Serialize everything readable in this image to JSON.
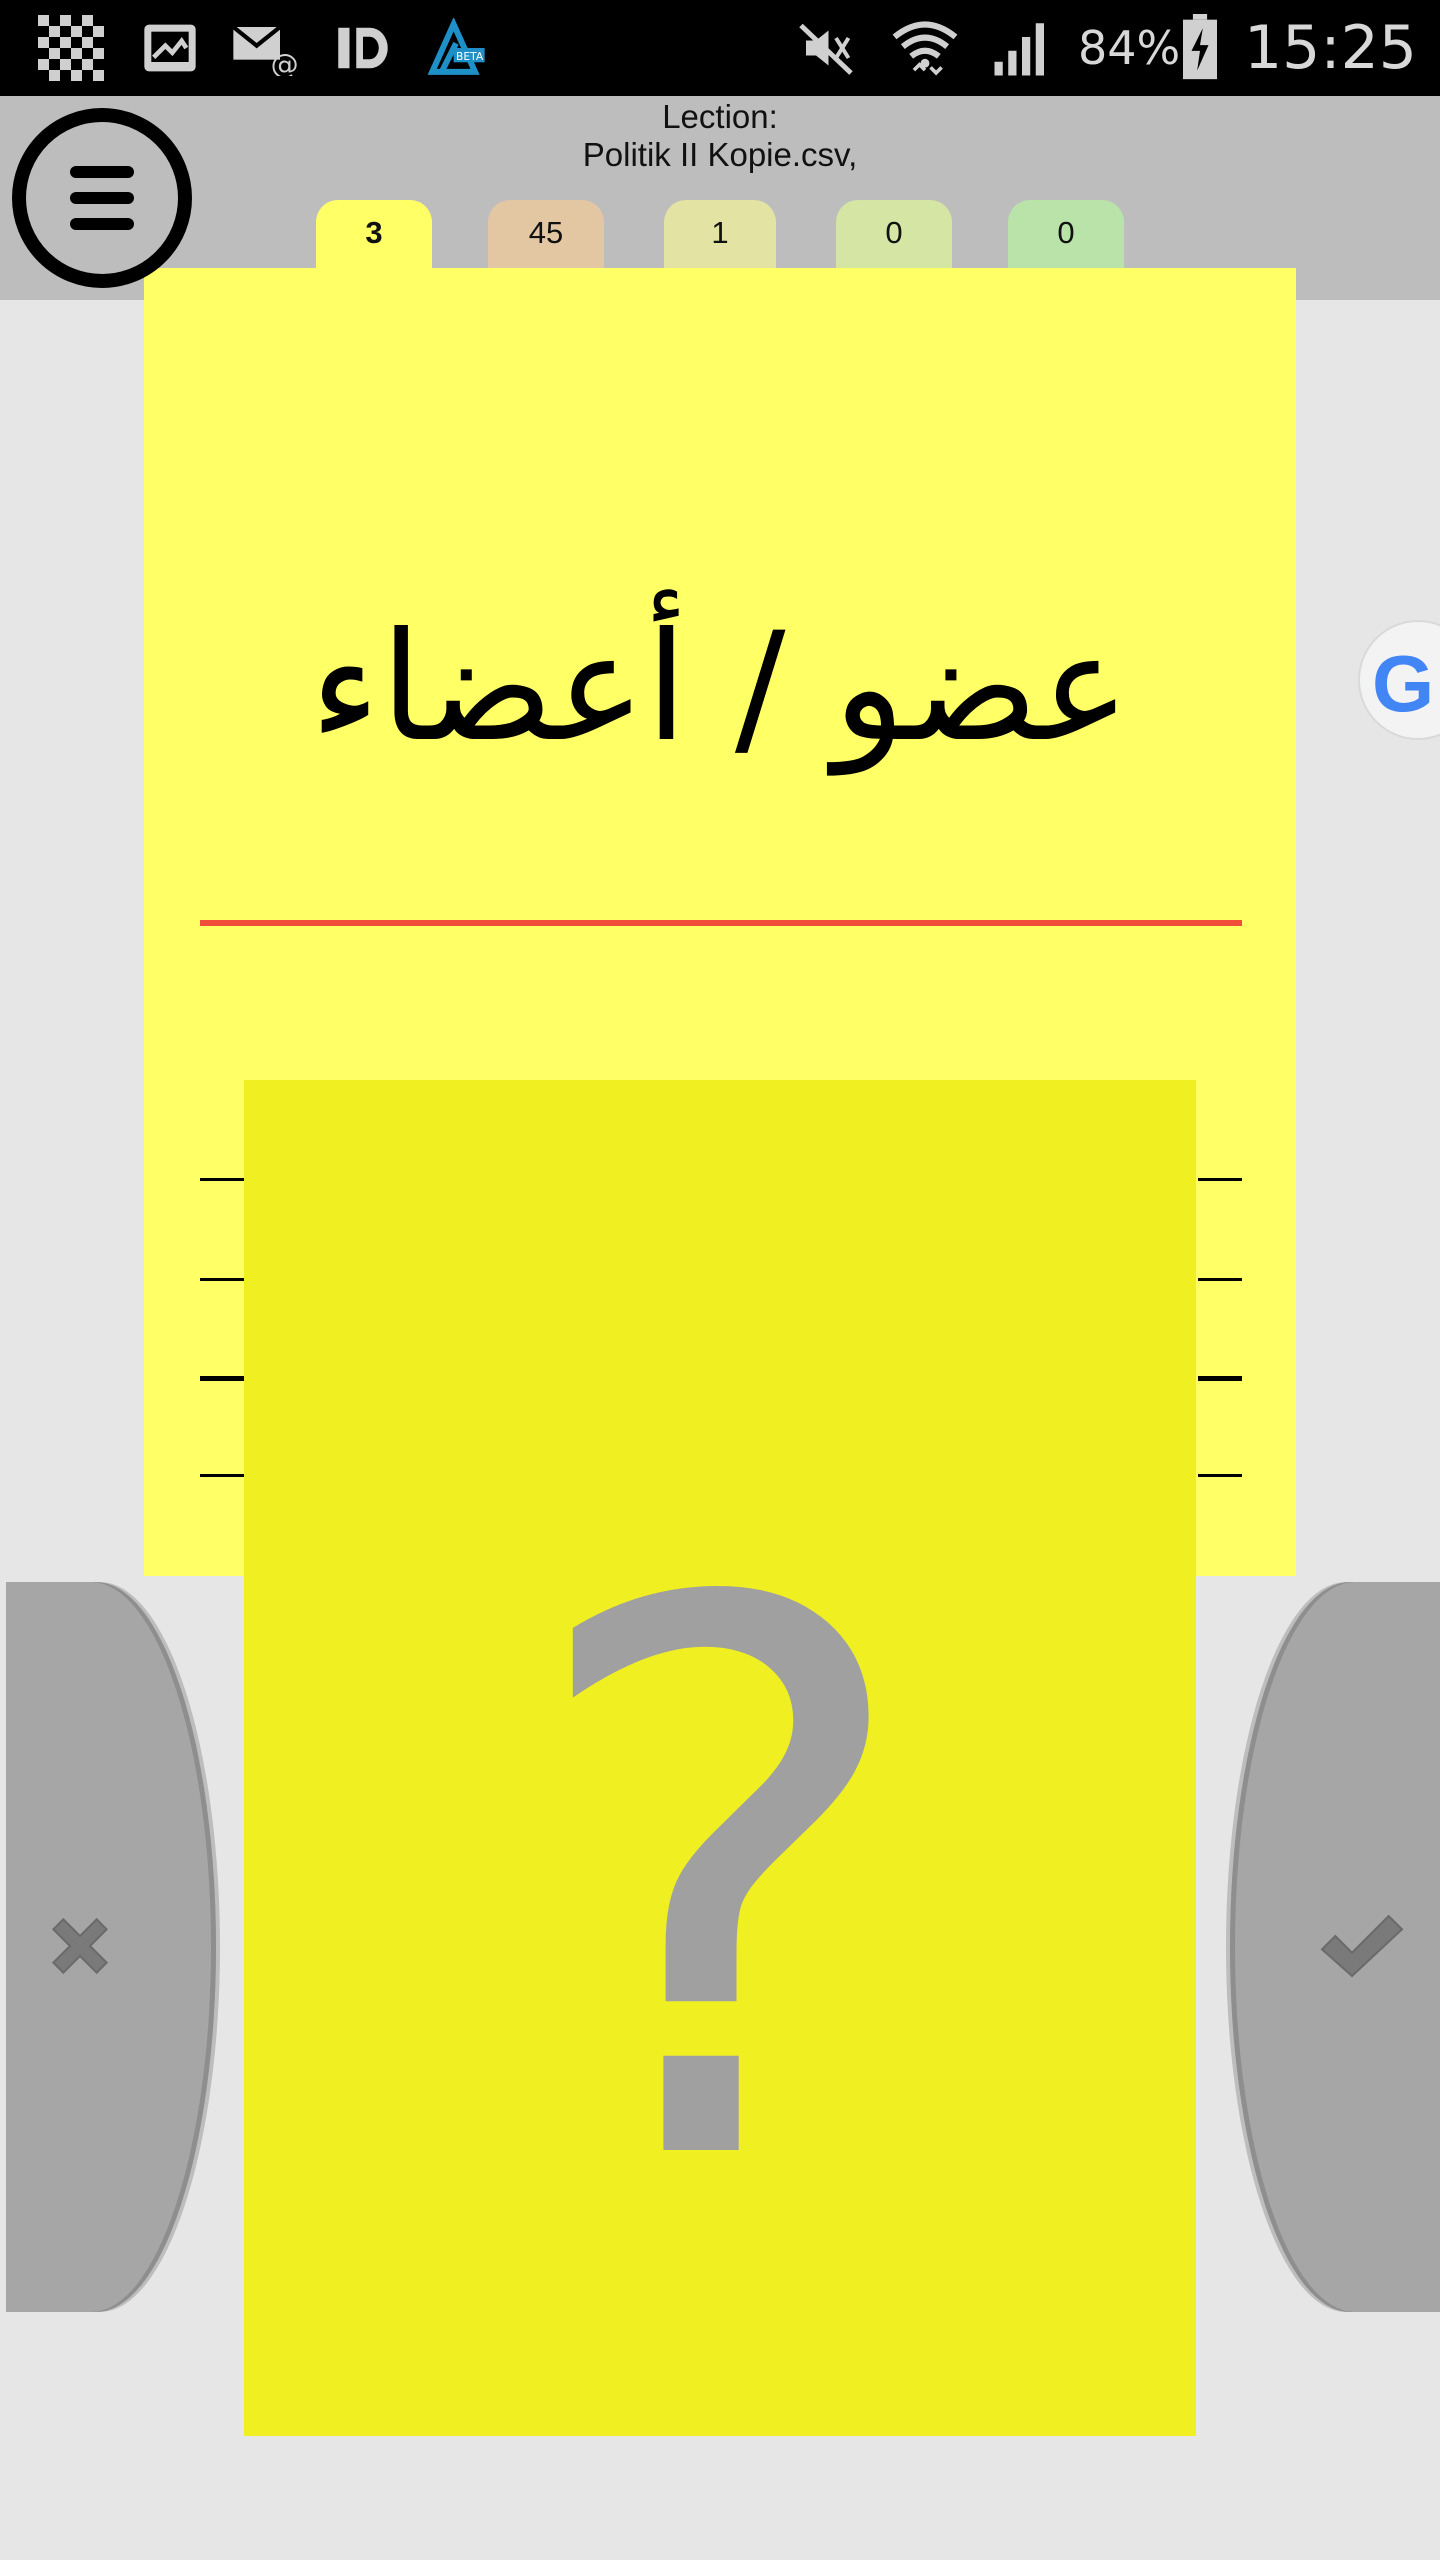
{
  "status_bar": {
    "icons_left": [
      "checker-icon",
      "image-icon",
      "mail-at-icon",
      "id-icon",
      "beta-app-icon"
    ],
    "icons_right": [
      "mute-icon",
      "wifi-icon",
      "signal-icon"
    ],
    "battery": "84%",
    "time": "15:25",
    "beta_badge": "BETA"
  },
  "header": {
    "lection_label": "Lection:",
    "lection_file": "Politik II Kopie.csv,",
    "tabs": [
      {
        "label": "3",
        "color": "#ffff66"
      },
      {
        "label": "45",
        "color": "#e3c7a3"
      },
      {
        "label": "1",
        "color": "#e3e3a3"
      },
      {
        "label": "0",
        "color": "#d5e5a3"
      },
      {
        "label": "0",
        "color": "#b9e3a8"
      }
    ]
  },
  "card": {
    "word": "عضو / أعضاء",
    "background": "#ffff66",
    "divider_color": "#f04e3a"
  },
  "cover": {
    "symbol": "?",
    "background": "#efef22"
  },
  "buttons": {
    "wrong_icon": "x-icon",
    "right_icon": "check-icon"
  },
  "google_bubble": {
    "letter": "G"
  }
}
